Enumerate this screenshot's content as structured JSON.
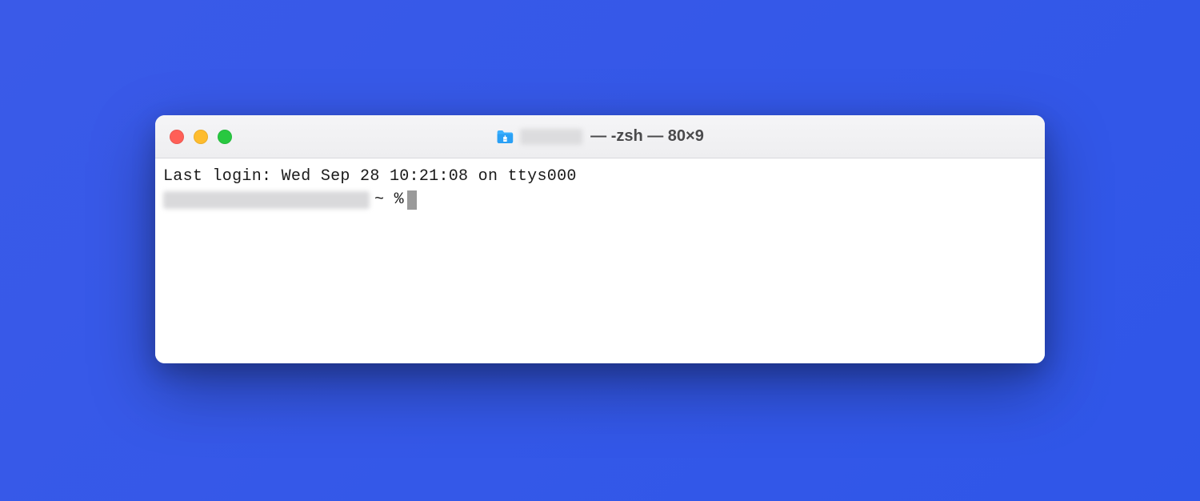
{
  "window": {
    "title_suffix": "— -zsh — 80×9"
  },
  "terminal": {
    "last_login_line": "Last login: Wed Sep 28 10:21:08 on ttys000",
    "prompt_path": "~",
    "prompt_symbol": "%"
  }
}
